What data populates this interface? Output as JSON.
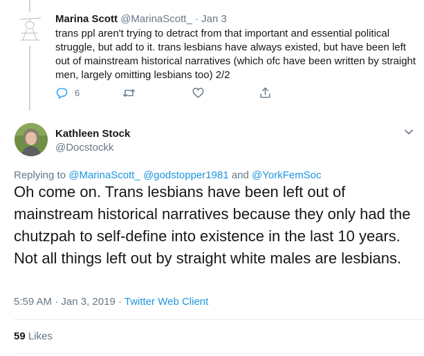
{
  "reply_tweet": {
    "name": "Marina Scott",
    "handle": "@MarinaScott_",
    "separator": "·",
    "date": "Jan 3",
    "text": "trans ppl aren't trying to detract from that important and essential political struggle, but add to it. trans lesbians have always existed, but have been left out of mainstream historical narratives (which ofc have been written by straight men, largely omitting lesbians too) 2/2",
    "reply_count": "6"
  },
  "main_tweet": {
    "name": "Kathleen Stock",
    "handle": "@Docstockk",
    "replying_label": "Replying to",
    "mentions": [
      "@MarinaScott_",
      "@godstopper1981",
      "@YorkFemSoc"
    ],
    "and_word": "and",
    "text": "Oh come on. Trans lesbians have been left out of mainstream historical narratives because they only had the chutzpah to self-define into existence in the last 10 years. Not all things left out by straight white males are lesbians.",
    "time": "5:59 AM",
    "date": "Jan 3, 2019",
    "separator": "·",
    "client": "Twitter Web Client",
    "likes_count": "59",
    "likes_label": "Likes"
  },
  "icons": [
    "reply-icon",
    "retweet-icon",
    "like-icon",
    "share-icon",
    "chevron-down-icon"
  ],
  "colors": {
    "link": "#1b95e0",
    "muted": "#657786",
    "text": "#14171a",
    "border": "#e6ecf0"
  }
}
